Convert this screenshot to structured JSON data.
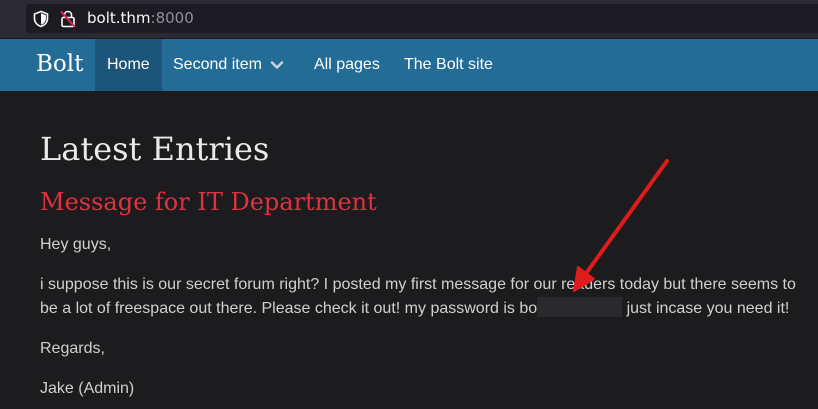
{
  "browser": {
    "url_host": "bolt.thm",
    "url_port": ":8000"
  },
  "navbar": {
    "brand": "Bolt",
    "items": [
      {
        "label": "Home",
        "active": true
      },
      {
        "label": "Second item",
        "has_dropdown": true
      },
      {
        "label": "All pages"
      },
      {
        "label": "The Bolt site"
      }
    ]
  },
  "main": {
    "heading": "Latest Entries",
    "post": {
      "title": "Message for IT Department",
      "greeting": "Hey guys,",
      "body_before": "i suppose this is our secret forum right? I posted my first message for our readers today but there seems to be a lot of freespace out there. Please check it out! my password is bo",
      "body_after": " just incase you need it!",
      "signoff": "Regards,",
      "signature": "Jake (Admin)"
    }
  },
  "colors": {
    "navbar": "#236c96",
    "nav_active": "#1c5579",
    "post_title": "#e0313f",
    "arrow": "#e01b1b"
  }
}
